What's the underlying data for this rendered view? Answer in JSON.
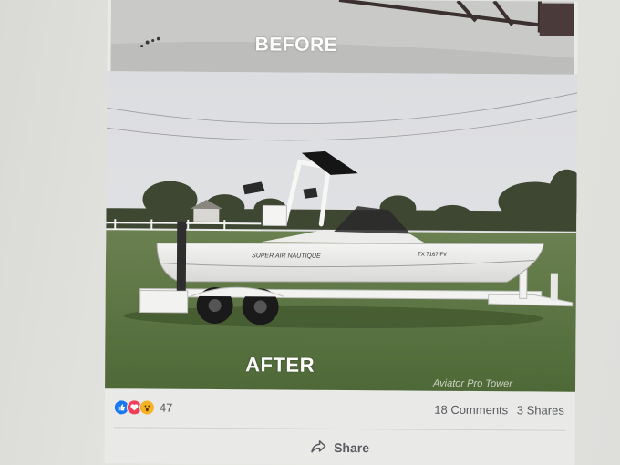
{
  "post": {
    "before_caption": "BEFORE",
    "after_caption": "AFTER",
    "watermark": "Aviator Pro Tower",
    "boat_name": "SUPER AIR NAUTIQUE",
    "boat_reg": "TX 7167 FV"
  },
  "stats": {
    "reaction_icons": [
      "like-icon",
      "love-icon",
      "wow-icon"
    ],
    "reaction_count": "47",
    "comments": "18 Comments",
    "shares": "3 Shares"
  },
  "actions": {
    "share_label": "Share"
  }
}
